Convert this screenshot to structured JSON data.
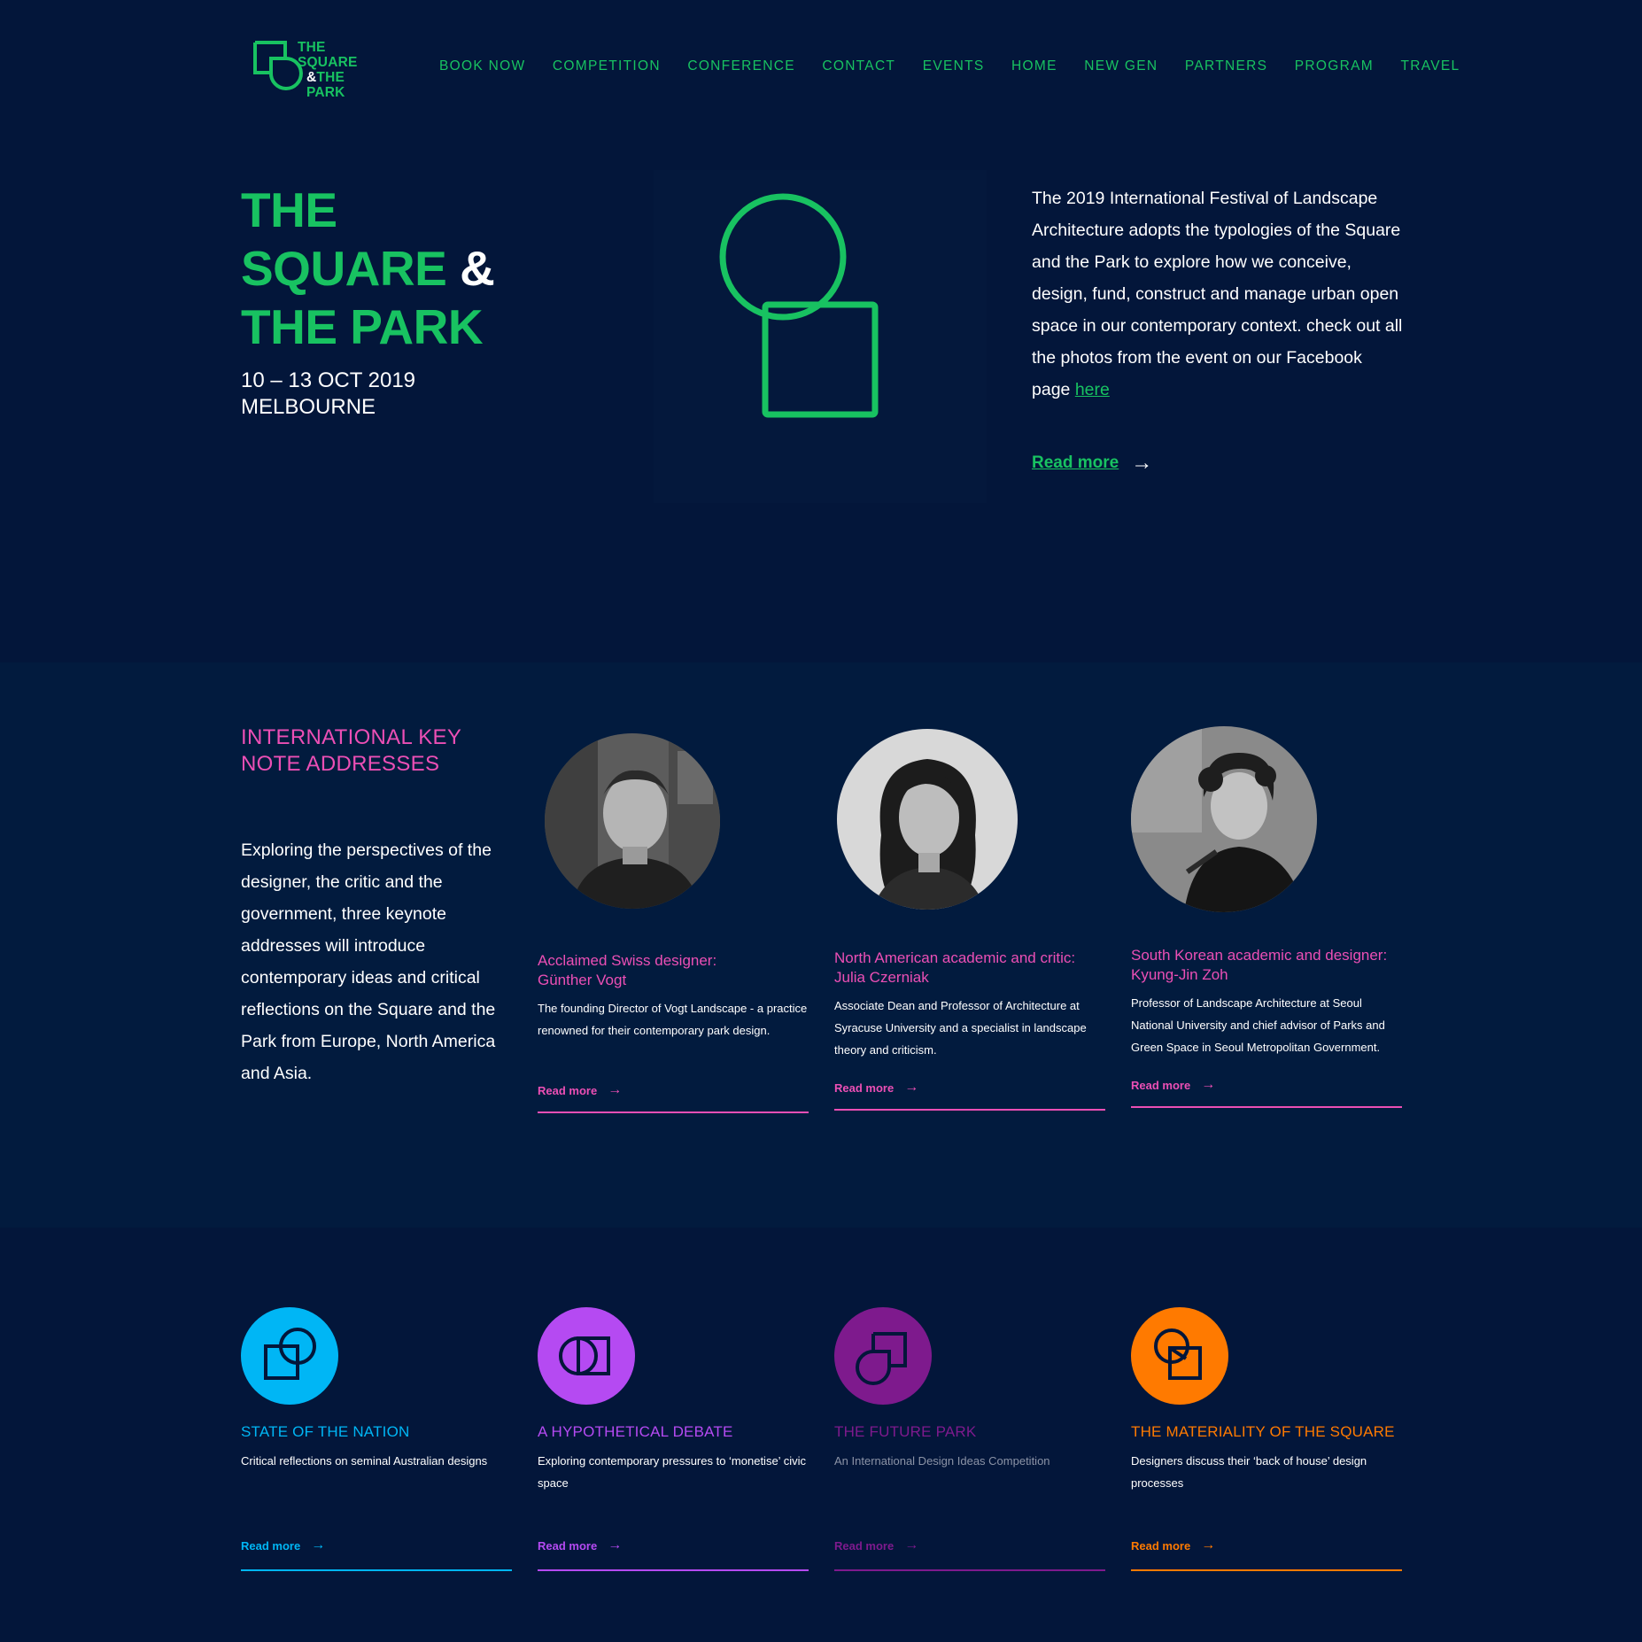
{
  "logo": {
    "line1": "THE",
    "line2": "SQUARE",
    "line3_amp": "&",
    "line3_rest": "THE",
    "line4": "PARK"
  },
  "nav": {
    "items": [
      "BOOK NOW",
      "COMPETITION",
      "CONFERENCE",
      "CONTACT",
      "EVENTS",
      "HOME",
      "NEW GEN",
      "PARTNERS",
      "PROGRAM",
      "TRAVEL"
    ]
  },
  "hero": {
    "title_line1": "THE",
    "title_line2": "SQUARE",
    "title_amp": "&",
    "title_line3": "THE PARK",
    "date": "10 – 13 OCT 2019",
    "location": "MELBOURNE",
    "description": "The 2019 International Festival of Landscape Architecture adopts the typologies of the Square and the Park to explore how we conceive, design, fund, construct and manage urban open space in our contemporary context. check out all the photos from the event on our Facebook page",
    "link_text": "here",
    "read_more": "Read more",
    "arrow": "→"
  },
  "keynotes": {
    "heading": "INTERNATIONAL KEY NOTE ADDRESSES",
    "intro": "Exploring the perspectives of the designer, the critic and the government, three keynote addresses will introduce contemporary ideas and critical reflections on the Square and the Park from Europe, North America and Asia.",
    "speakers": [
      {
        "title_line1": "Acclaimed Swiss designer:",
        "title_line2": "Günther Vogt",
        "description": "The founding Director of Vogt Landscape - a practice renowned for their contemporary park design.",
        "read_more": "Read more"
      },
      {
        "title_line1": "North American academic and critic:",
        "title_line2": "Julia Czerniak",
        "description": "Associate Dean and Professor of Architecture at Syracuse University and a specialist in landscape theory and criticism.",
        "read_more": "Read more"
      },
      {
        "title_line1": "South Korean academic and designer:",
        "title_line2": "Kyung-Jin Zoh",
        "description": "Professor of Landscape Architecture at Seoul National University and chief advisor of Parks and Green Space in Seoul Metropolitan Government.",
        "read_more": "Read more"
      }
    ]
  },
  "themes": {
    "items": [
      {
        "title": "STATE OF THE NATION",
        "description": "Critical reflections on seminal Australian designs",
        "read_more": "Read more",
        "color": "#00b6f5",
        "icon": "square-circle-icon"
      },
      {
        "title": "A HYPOTHETICAL DEBATE",
        "description": "Exploring contemporary pressures to ‘monetise’ civic space",
        "read_more": "Read more",
        "color": "#b54af2",
        "icon": "half-circle-square-icon"
      },
      {
        "title": "THE FUTURE PARK",
        "description": "An International Design Ideas Competition",
        "read_more": "Read more",
        "color": "#7e1a8d",
        "icon": "square-notch-icon"
      },
      {
        "title": "THE MATERIALITY OF THE SQUARE",
        "description": "Designers discuss their ‘back of house’ design processes",
        "read_more": "Read more",
        "color": "#ff7a00",
        "icon": "circle-square-overlap-icon"
      }
    ]
  },
  "colors": {
    "green": "#18c261",
    "pink": "#ec4fb5",
    "navy": "#03163a"
  }
}
